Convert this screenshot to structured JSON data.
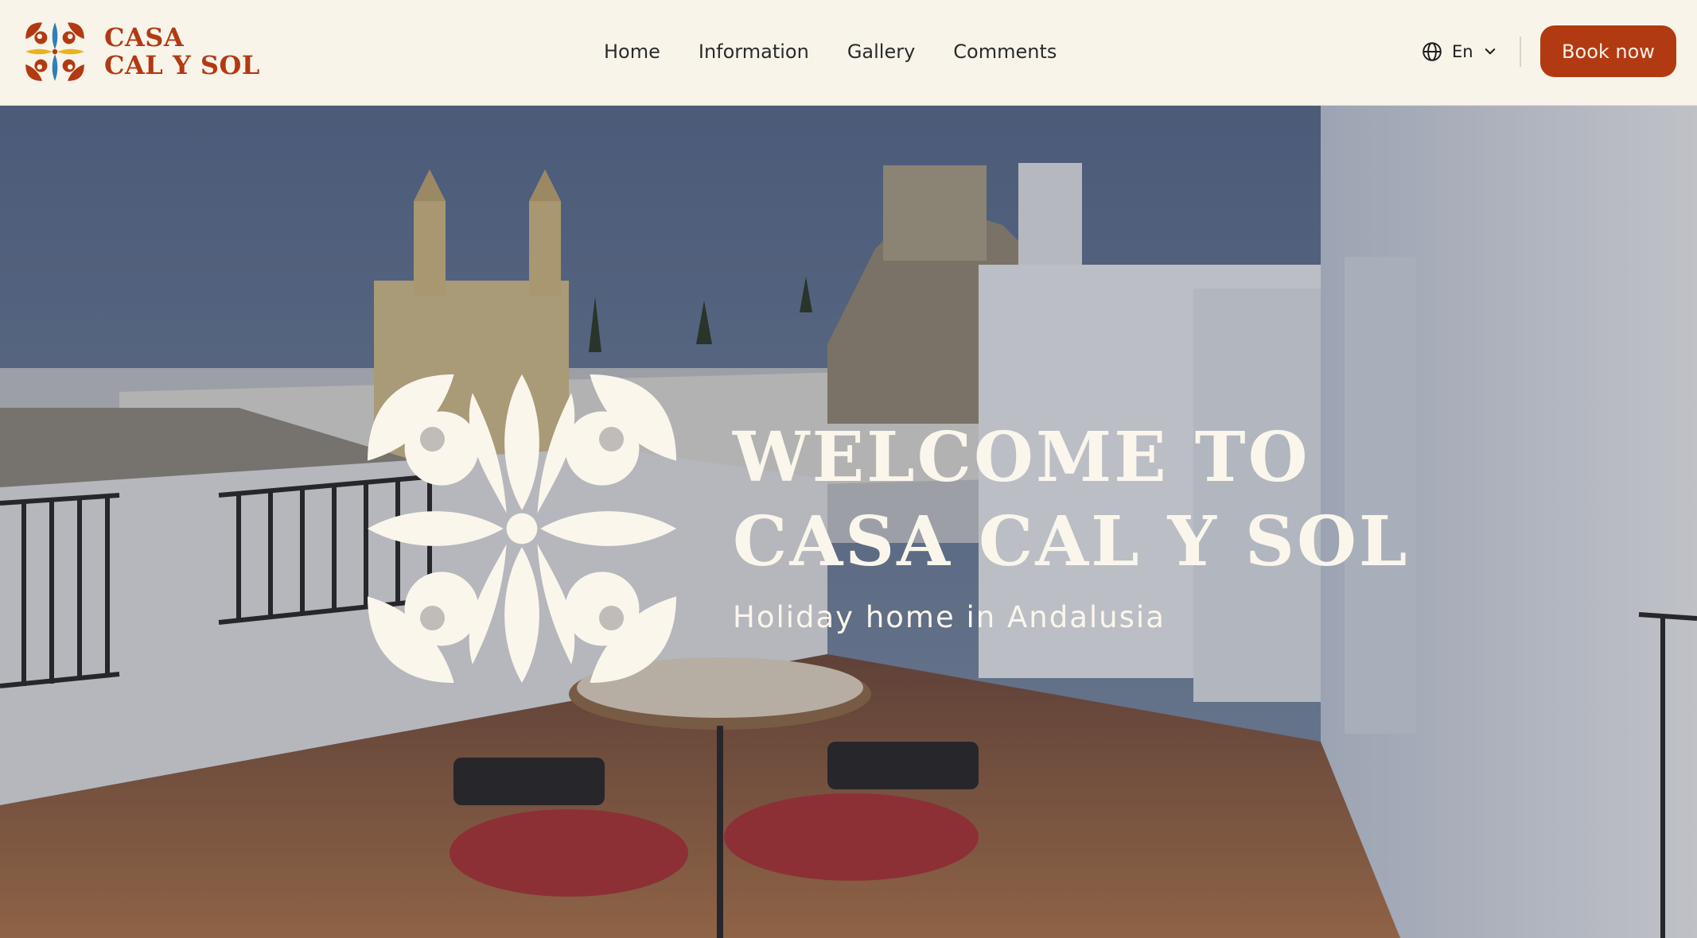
{
  "brand": {
    "name_line1": "CASA",
    "name_line2": "CAL Y SOL",
    "color": "#b23a12",
    "logo_icon": "tile-flower-logo-icon"
  },
  "nav": {
    "items": [
      {
        "label": "Home"
      },
      {
        "label": "Information"
      },
      {
        "label": "Gallery"
      },
      {
        "label": "Comments"
      }
    ]
  },
  "language": {
    "icon": "globe-icon",
    "selected": "En",
    "dropdown_icon": "chevron-down-icon"
  },
  "cta": {
    "book_label": "Book now",
    "color": "#b23a12"
  },
  "hero": {
    "title_line1": "WELCOME TO",
    "title_line2": "CASA CAL Y SOL",
    "subtitle": "Holiday home in Andalusia",
    "text_color": "#fbf6ec",
    "emblem_icon": "tile-flower-emblem-icon"
  }
}
